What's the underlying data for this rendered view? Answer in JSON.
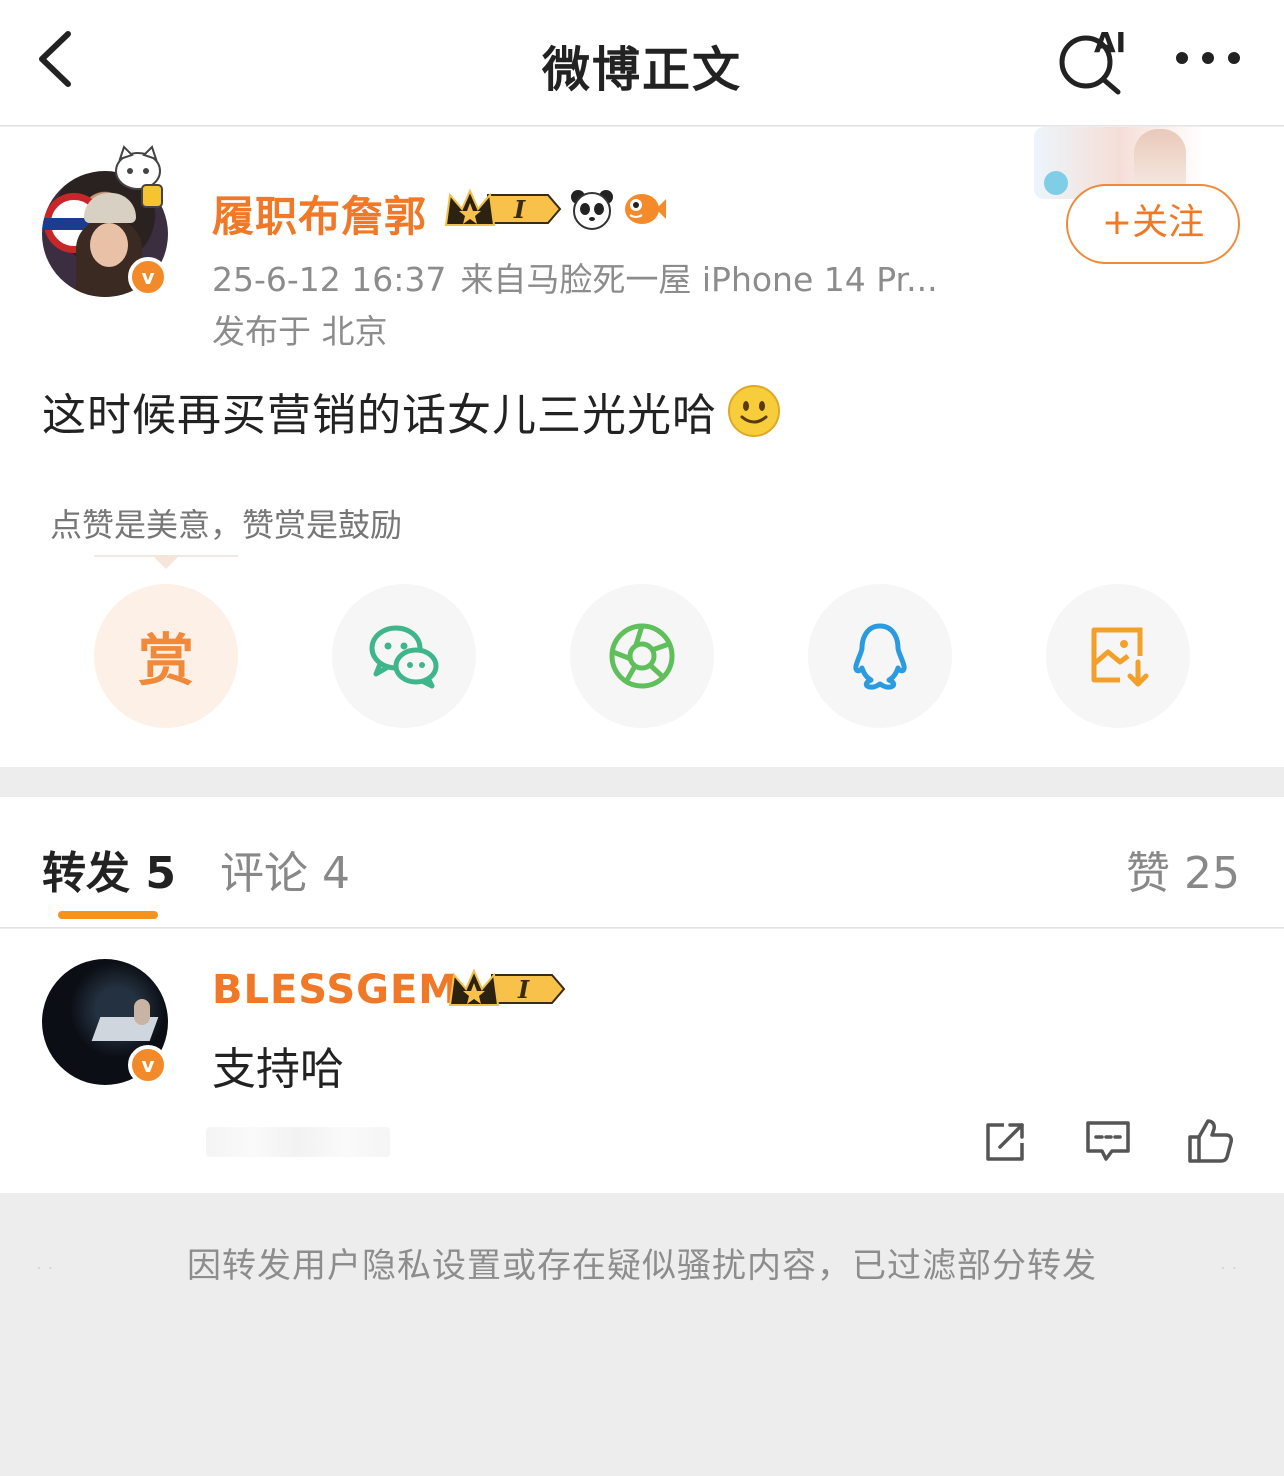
{
  "header": {
    "title": "微博正文",
    "ai_label": "AI"
  },
  "post": {
    "author": "履职布詹郭",
    "time": "25-6-12 16:37",
    "source": "来自马脸死一屋 iPhone 14 Pr...",
    "location": "发布于 北京",
    "follow_label": "+关注",
    "text": "这时候再买营销的话女儿三光光哈",
    "reward_tip": "点赞是美意，赞赏是鼓励",
    "reward_label": "赏",
    "verified_mark": "v",
    "badge_level": "I"
  },
  "tabs": {
    "repost": "转发 5",
    "comment": "评论 4",
    "like": "赞 25"
  },
  "reposts": [
    {
      "name": "BLESSGEM",
      "text": "支持哈",
      "verified_mark": "v",
      "badge_level": "I"
    }
  ],
  "notice": "因转发用户隐私设置或存在疑似骚扰内容，已过滤部分转发",
  "colors": {
    "accent": "#f07826",
    "tab_underline": "#f5931f",
    "wechat": "#3fb58c",
    "moments": "#5fbf5a",
    "qq": "#2b9be0",
    "save": "#f3a02b"
  }
}
